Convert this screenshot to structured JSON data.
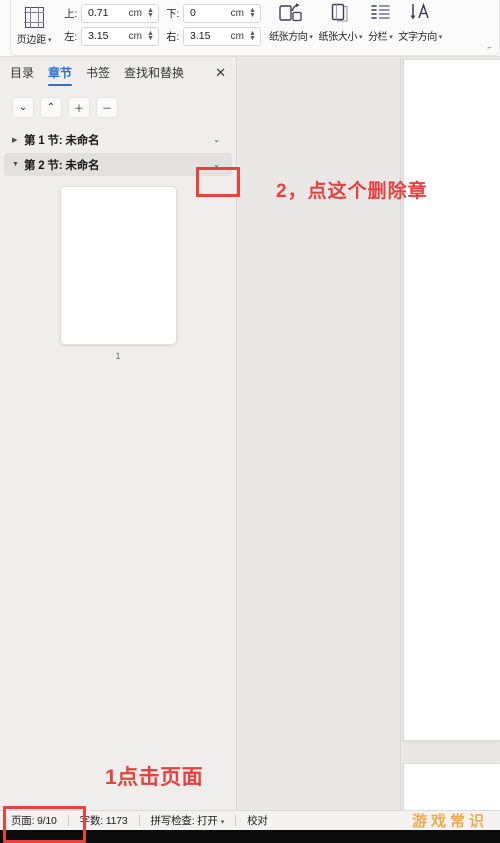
{
  "ribbon": {
    "margins_button": {
      "label": "页边距",
      "icon": "page-margins-icon"
    },
    "fields": [
      {
        "label": "上:",
        "value": "0.71",
        "unit": "cm"
      },
      {
        "label": "下:",
        "value": "0",
        "unit": "cm"
      },
      {
        "label": "左:",
        "value": "3.15",
        "unit": "cm"
      },
      {
        "label": "右:",
        "value": "3.15",
        "unit": "cm"
      }
    ],
    "buttons": [
      {
        "label": "纸张方向",
        "icon": "page-orientation-icon"
      },
      {
        "label": "纸张大小",
        "icon": "page-size-icon"
      },
      {
        "label": "分栏",
        "icon": "columns-icon"
      },
      {
        "label": "文字方向",
        "icon": "text-direction-icon"
      }
    ],
    "expand_glyph": "⌐"
  },
  "sidebar": {
    "tabs": [
      {
        "label": "目录",
        "active": false
      },
      {
        "label": "章节",
        "active": true
      },
      {
        "label": "书签",
        "active": false
      },
      {
        "label": "查找和替换",
        "active": false
      }
    ],
    "close_label": "✕",
    "toolbar": [
      {
        "name": "next-section-button",
        "glyph": "⌄"
      },
      {
        "name": "prev-section-button",
        "glyph": "⌃"
      },
      {
        "name": "add-section-button",
        "glyph": "＋"
      },
      {
        "name": "remove-section-button",
        "glyph": "－"
      }
    ],
    "sections": [
      {
        "triangle": "▶",
        "title": "第 1 节: 未命名",
        "menu": "⌄",
        "selected": false
      },
      {
        "triangle": "▼",
        "title": "第 2 节: 未命名",
        "menu": "⌄",
        "selected": true
      }
    ],
    "thumbnail": {
      "page_number": "1"
    }
  },
  "statusbar": {
    "page_label": "页面: 9/10",
    "word_count": "字数: 1173",
    "spellcheck": "拼写检查: 打开",
    "spellcheck_caret": "⌄",
    "proofread": "校对"
  },
  "annotations": {
    "step2_text": "2，点这个删除章",
    "step1_text": "1点击页面",
    "accent_color": "#e8413f"
  },
  "watermark": {
    "text": "游戏常识",
    "color": "#f0a23c"
  }
}
